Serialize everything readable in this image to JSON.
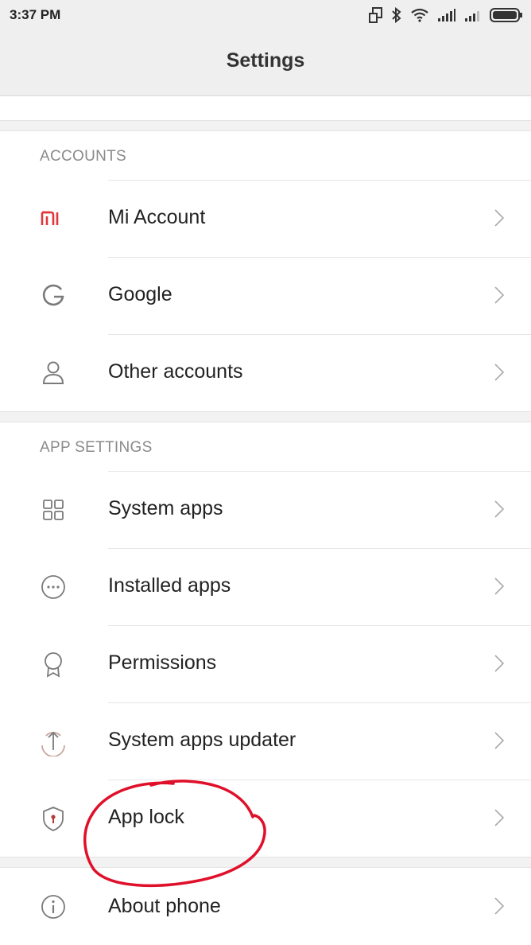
{
  "status": {
    "time": "3:37 PM"
  },
  "header": {
    "title": "Settings"
  },
  "accounts": {
    "header": "ACCOUNTS",
    "items": [
      {
        "label": "Mi Account",
        "icon": "mi-logo-icon"
      },
      {
        "label": "Google",
        "icon": "google-icon"
      },
      {
        "label": "Other accounts",
        "icon": "person-icon"
      }
    ]
  },
  "app_settings": {
    "header": "APP SETTINGS",
    "items": [
      {
        "label": "System apps",
        "icon": "grid-icon"
      },
      {
        "label": "Installed apps",
        "icon": "more-dots-icon"
      },
      {
        "label": "Permissions",
        "icon": "badge-icon"
      },
      {
        "label": "System apps updater",
        "icon": "upload-arrow-icon"
      },
      {
        "label": "App lock",
        "icon": "shield-lock-icon"
      }
    ]
  },
  "other": {
    "items": [
      {
        "label": "About phone",
        "icon": "info-icon"
      }
    ]
  },
  "colors": {
    "mi_red": "#e0363d",
    "annotation_red": "#e0102a",
    "icon_gray": "#8a8a8a"
  }
}
